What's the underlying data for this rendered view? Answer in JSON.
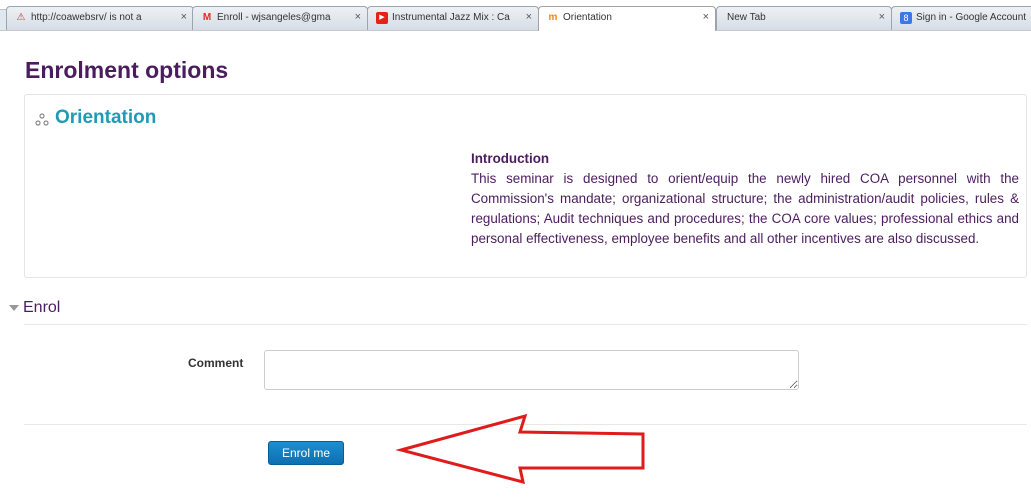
{
  "browser": {
    "tabs": [
      {
        "title": "http://coawebsrv/ is not a",
        "favicon": "warning-icon",
        "favicon_color": "#c0392b"
      },
      {
        "title": "Enroll - wjsangeles@gma",
        "favicon": "gmail-icon",
        "favicon_color": "#d93025"
      },
      {
        "title": "Instrumental Jazz Mix : Ca",
        "favicon": "youtube-icon",
        "favicon_color": "#e62117"
      },
      {
        "title": "Orientation",
        "favicon": "moodle-icon",
        "favicon_color": "#f98012"
      },
      {
        "title": "New Tab",
        "favicon": "",
        "favicon_color": ""
      },
      {
        "title": "Sign in - Google Account",
        "favicon": "google-icon",
        "favicon_color": "#3b78e7"
      }
    ],
    "close_glyph": "×"
  },
  "page": {
    "title": "Enrolment options",
    "course": {
      "name": "Orientation",
      "summary_heading": "Introduction",
      "summary_text": "This seminar is designed to orient/equip the newly hired COA personnel with the Commission's mandate; organizational structure; the administration/audit policies, rules & regulations; Audit techniques and procedures; the COA core values; professional ethics and personal effectiveness, employee benefits and all other incentives are also discussed."
    },
    "enrol": {
      "legend": "Enrol",
      "comment_label": "Comment",
      "comment_value": "",
      "button_label": "Enrol me"
    }
  },
  "colors": {
    "heading": "#4b1d5e",
    "course_link": "#1e9bb5",
    "button": "#1482c4",
    "arrow": "#e01b1b"
  }
}
